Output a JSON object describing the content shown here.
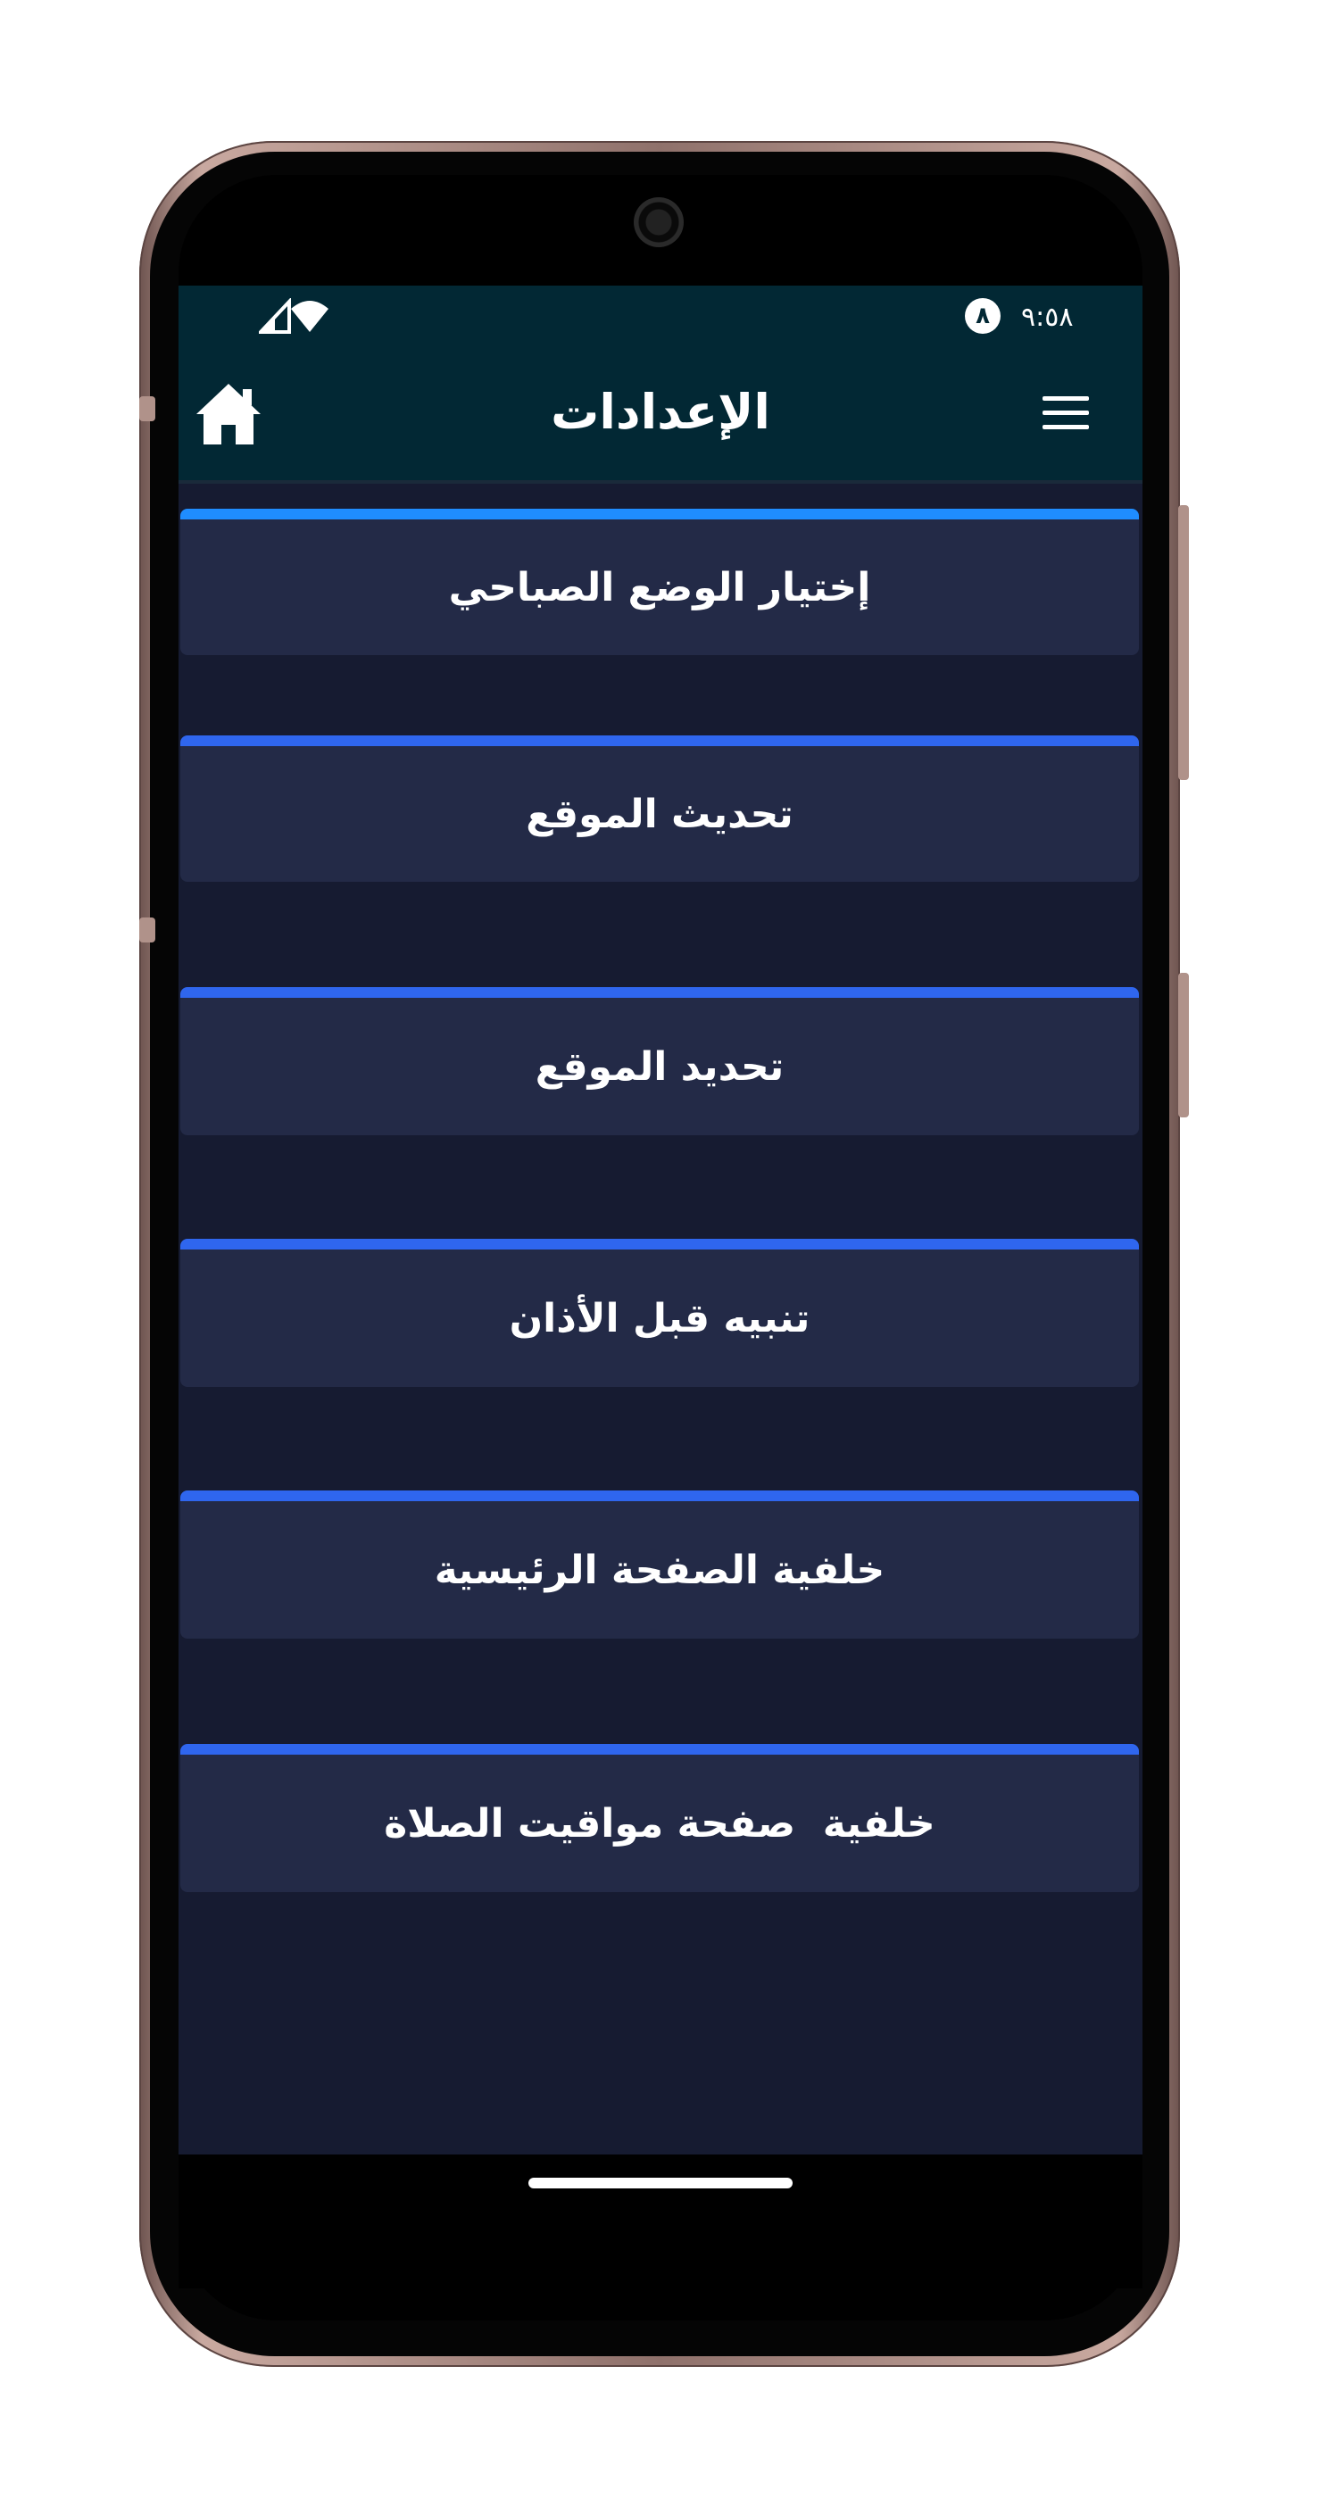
{
  "status_bar": {
    "time": "٩:٥٨",
    "badge": "٨",
    "icons": [
      "signal-icon",
      "wifi-icon"
    ]
  },
  "app_bar": {
    "title": "الإعدادات",
    "left_icon": "home-icon",
    "right_icon": "menu-icon"
  },
  "settings": {
    "items": [
      {
        "label": "إختيار الوضع الصباحي"
      },
      {
        "label": "تحديث الموقع"
      },
      {
        "label": "تحديد الموقع"
      },
      {
        "label": "تنبيه قبل الأذان"
      },
      {
        "label": "خلفية الصفحة الرئيسية"
      },
      {
        "label": "خلفية  صفحة مواقيت الصلاة"
      }
    ]
  },
  "colors": {
    "app_bar": "#022834",
    "background": "#161b31",
    "item_background": "#232a47",
    "item_accent": "#2f66ee",
    "first_item_accent": "#1f8dff",
    "phone_frame": "#c9a9a0"
  }
}
